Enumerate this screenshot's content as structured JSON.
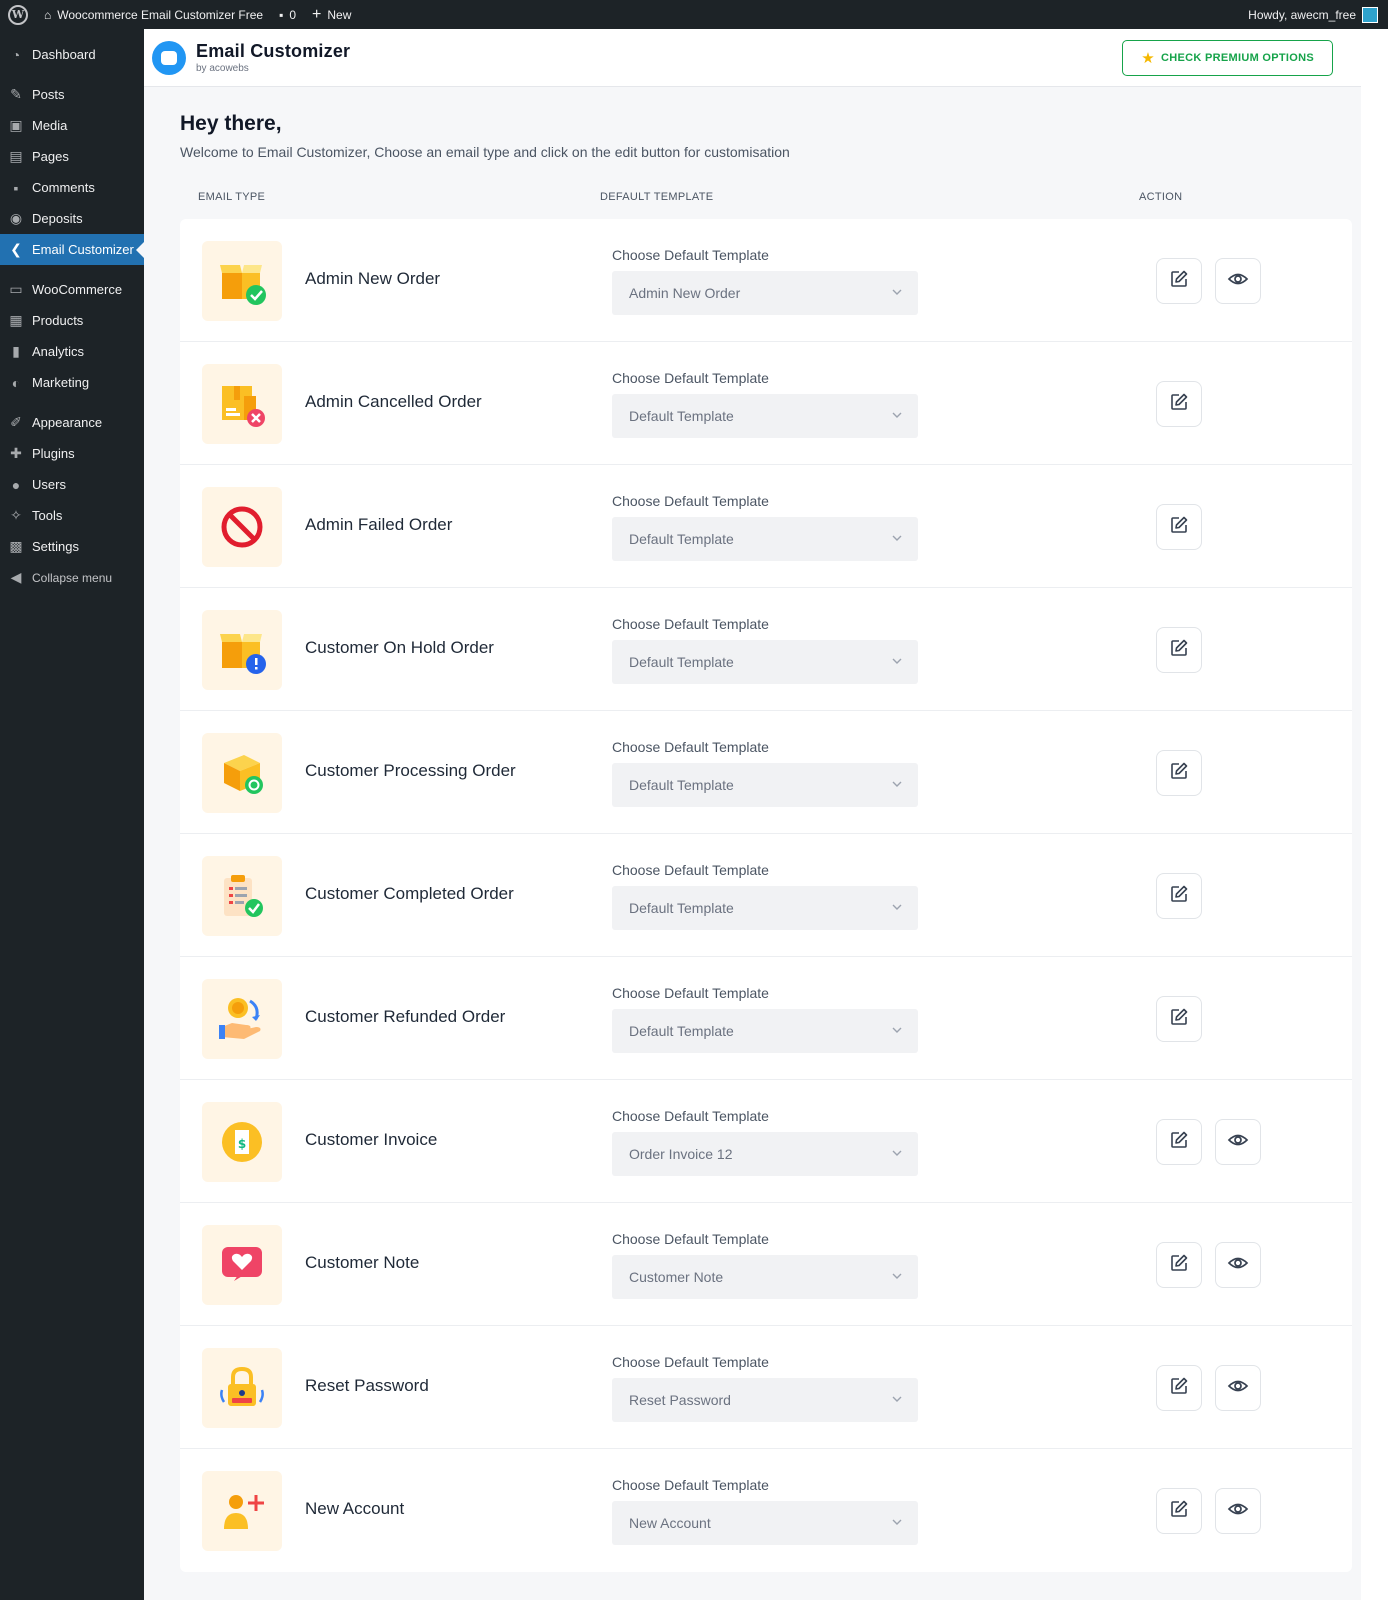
{
  "admin_bar": {
    "site_name": "Woocommerce Email Customizer Free",
    "comments_count": "0",
    "new_label": "New",
    "howdy": "Howdy, awecm_free"
  },
  "sidebar": {
    "items": [
      {
        "label": "Dashboard",
        "icon": "dashboard-icon"
      },
      {
        "label": "Posts",
        "icon": "pin-icon"
      },
      {
        "label": "Media",
        "icon": "media-icon"
      },
      {
        "label": "Pages",
        "icon": "page-icon"
      },
      {
        "label": "Comments",
        "icon": "comment-icon"
      },
      {
        "label": "Deposits",
        "icon": "deposits-icon"
      },
      {
        "label": "Email Customizer",
        "icon": "email-customizer-icon",
        "active": true
      },
      {
        "label": "WooCommerce",
        "icon": "woo-icon"
      },
      {
        "label": "Products",
        "icon": "products-icon"
      },
      {
        "label": "Analytics",
        "icon": "analytics-icon"
      },
      {
        "label": "Marketing",
        "icon": "megaphone-icon"
      },
      {
        "label": "Appearance",
        "icon": "brush-icon"
      },
      {
        "label": "Plugins",
        "icon": "plugin-icon"
      },
      {
        "label": "Users",
        "icon": "user-icon"
      },
      {
        "label": "Tools",
        "icon": "wrench-icon"
      },
      {
        "label": "Settings",
        "icon": "settings-icon"
      },
      {
        "label": "Collapse menu",
        "icon": "collapse-icon"
      }
    ]
  },
  "header": {
    "title": "Email Customizer",
    "subtitle": "by acowebs",
    "premium_button": "CHECK PREMIUM OPTIONS"
  },
  "main": {
    "greeting": "Hey there,",
    "welcome": "Welcome to Email Customizer, Choose an email type and click on the edit button for customisation",
    "columns": {
      "email_type": "EMAIL TYPE",
      "default_template": "DEFAULT TEMPLATE",
      "action": "ACTION"
    },
    "template_label": "Choose Default Template",
    "rows": [
      {
        "title": "Admin New Order",
        "template": "Admin New Order",
        "icon": "box-check-icon",
        "preview": true
      },
      {
        "title": "Admin Cancelled Order",
        "template": "Default Template",
        "icon": "box-cancel-icon",
        "preview": false
      },
      {
        "title": "Admin Failed Order",
        "template": "Default Template",
        "icon": "prohibited-icon",
        "preview": false
      },
      {
        "title": "Customer On Hold Order",
        "template": "Default Template",
        "icon": "box-alert-icon",
        "preview": false
      },
      {
        "title": "Customer Processing Order",
        "template": "Default Template",
        "icon": "box-processing-icon",
        "preview": false
      },
      {
        "title": "Customer Completed Order",
        "template": "Default Template",
        "icon": "clipboard-check-icon",
        "preview": false
      },
      {
        "title": "Customer Refunded Order",
        "template": "Default Template",
        "icon": "refund-coin-icon",
        "preview": false
      },
      {
        "title": "Customer Invoice",
        "template": "Order Invoice 12",
        "icon": "invoice-icon",
        "preview": true
      },
      {
        "title": "Customer Note",
        "template": "Customer Note",
        "icon": "heart-note-icon",
        "preview": true
      },
      {
        "title": "Reset Password",
        "template": "Reset Password",
        "icon": "padlock-icon",
        "preview": true
      },
      {
        "title": "New Account",
        "template": "New Account",
        "icon": "add-user-icon",
        "preview": true
      }
    ]
  },
  "colors": {
    "admin_bg": "#1d2327",
    "active_menu": "#2271b1",
    "accent_green": "#16a34a",
    "tile_bg": "#fff5e5"
  }
}
